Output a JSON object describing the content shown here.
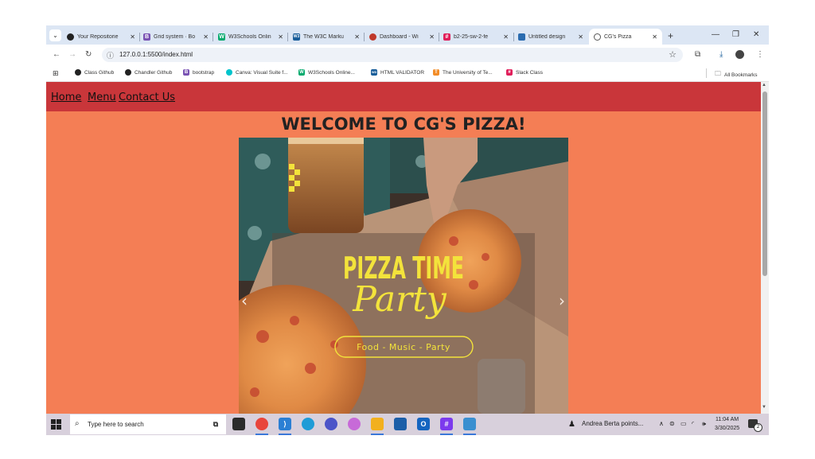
{
  "browser": {
    "tabs": [
      {
        "title": "Your Repositorie",
        "icon": "github-icon",
        "color": "#222222"
      },
      {
        "title": "Grid system · Bo",
        "icon": "bootstrap-icon",
        "color": "#7952b3"
      },
      {
        "title": "W3Schools Onlin",
        "icon": "w3schools-icon",
        "color": "#04aa6d"
      },
      {
        "title": "The W3C Marku",
        "icon": "w3c-icon",
        "color": "#1a5e9a"
      },
      {
        "title": "Dashboard - Wi",
        "icon": "dashboard-icon",
        "color": "#c0392b"
      },
      {
        "title": "b2-25-sw-2-fe",
        "icon": "slack-icon",
        "color": "#e01e5a"
      },
      {
        "title": "Untitled design",
        "icon": "canva-icon",
        "color": "#2b6cb0"
      },
      {
        "title": "CG's Pizza",
        "icon": "globe-icon",
        "color": "#555555",
        "active": true
      }
    ],
    "url": "127.0.0.1:5500/index.html",
    "bookmarks": [
      {
        "label": "Class Github",
        "icon": "github-icon",
        "color": "#222222"
      },
      {
        "label": "Chandler Github",
        "icon": "github-icon",
        "color": "#222222"
      },
      {
        "label": "bootstrap",
        "icon": "bootstrap-icon",
        "color": "#7952b3"
      },
      {
        "label": "Canva: Visual Suite f...",
        "icon": "canva-icon",
        "color": "#00c4cc"
      },
      {
        "label": "W3Schools Online...",
        "icon": "w3schools-icon",
        "color": "#04aa6d"
      },
      {
        "label": "HTML VALIDATOR",
        "icon": "w3c-icon",
        "color": "#1a5e9a"
      },
      {
        "label": "The University of Te...",
        "icon": "ut-icon",
        "color": "#f28c28"
      },
      {
        "label": "Slack Class",
        "icon": "slack-icon",
        "color": "#e01e5a"
      }
    ],
    "all_bookmarks": "All Bookmarks"
  },
  "site": {
    "nav": {
      "home": "Home",
      "menu": "Menu",
      "contact": "Contact Us"
    },
    "heading": "WELCOME TO CG'S PIZZA!",
    "slide": {
      "title": "PIZZA TIME",
      "subtitle": "Party",
      "tagline": "Food - Music - Party"
    },
    "colors": {
      "nav_bg": "#c9363a",
      "page_bg": "#f47e55",
      "slide_yellow": "#f3e33b"
    }
  },
  "taskbar": {
    "search_placeholder": "Type here to search",
    "notification": "Andrea Berta points...",
    "time": "11:04 AM",
    "date": "3/30/2025",
    "notif_count": "2"
  }
}
